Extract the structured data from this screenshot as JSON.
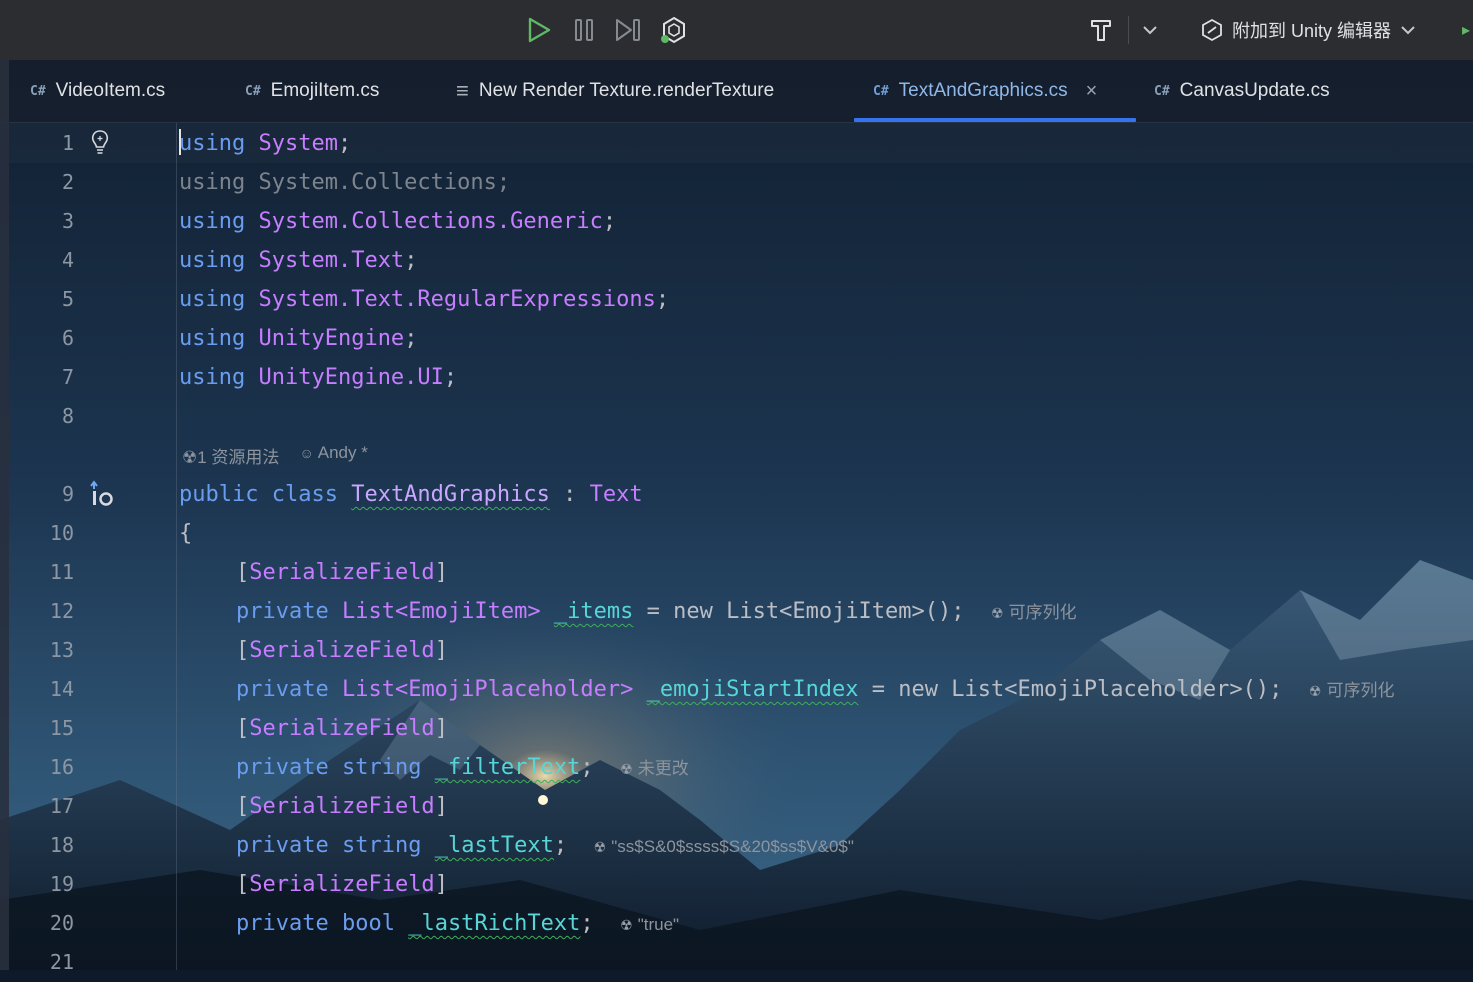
{
  "toolbar": {
    "run_icon": "play-icon",
    "pause_icon": "pause-icon",
    "step_icon": "step-icon",
    "debug_icon": "unity-debug-icon",
    "build_icon": "hammer-icon",
    "attach_label": "附加到 Unity 编辑器"
  },
  "tabs": [
    {
      "icon": "C#",
      "label": "VideoItem.cs"
    },
    {
      "icon": "C#",
      "label": "EmojiItem.cs"
    },
    {
      "icon": "≡",
      "label": "New Render Texture.renderTexture"
    },
    {
      "icon": "C#",
      "label": "TextAndGraphics.cs",
      "active": true,
      "close": "×"
    },
    {
      "icon": "C#",
      "label": "CanvasUpdate.cs"
    }
  ],
  "line_numbers": [
    "1",
    "2",
    "3",
    "4",
    "5",
    "6",
    "7",
    "8",
    "9",
    "10",
    "11",
    "12",
    "13",
    "14",
    "15",
    "16",
    "17",
    "18",
    "19",
    "20",
    "21"
  ],
  "code_lens": {
    "usages": "1 资源用法",
    "author": "Andy *"
  },
  "code": {
    "l1": {
      "kw": "using",
      "ns": "System",
      "end": ";"
    },
    "l2": "using System.Collections;",
    "l3": {
      "kw": "using",
      "ns": "System.Collections.Generic",
      "end": ";"
    },
    "l4": {
      "kw": "using",
      "ns": "System.Text",
      "end": ";"
    },
    "l5": {
      "kw": "using",
      "ns": "System.Text.RegularExpressions",
      "end": ";"
    },
    "l6": {
      "kw": "using",
      "ns": "UnityEngine",
      "end": ";"
    },
    "l7": {
      "kw": "using",
      "ns": "UnityEngine.UI",
      "end": ";"
    },
    "l9": {
      "mods": "public class",
      "name": "TextAndGraphics",
      "colon": " : ",
      "base": "Text"
    },
    "l10": "{",
    "attr": "SerializeField",
    "l12": {
      "mod": "private",
      "type": "List<EmojiItem>",
      "name": "_items",
      "rest": " = new List<EmojiItem>();",
      "hint": "可序列化"
    },
    "l14": {
      "mod": "private",
      "type": "List<EmojiPlaceholder>",
      "name": "_emojiStartIndex",
      "rest": " = new List<EmojiPlaceholder>();",
      "hint": "可序列化"
    },
    "l16": {
      "mod": "private",
      "type": "string",
      "name": "_filterText",
      "hint": "未更改"
    },
    "l18": {
      "mod": "private",
      "type": "string",
      "name": "_lastText",
      "hint": "\"ss$S&0$ssss$S&20$ss$V&0$\""
    },
    "l20": {
      "mod": "private",
      "type": "bool",
      "name": "_lastRichText",
      "hint": "\"true\""
    }
  },
  "colors": {
    "keyword": "#6a9cf0",
    "type": "#c77dff",
    "field": "#56d6d6",
    "active_tab_underline": "#3574f0"
  }
}
